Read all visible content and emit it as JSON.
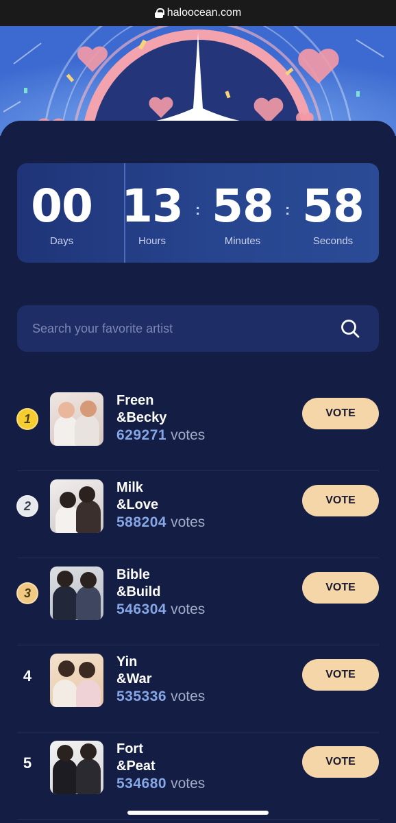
{
  "browser": {
    "url": "haloocean.com"
  },
  "countdown": {
    "days": "00",
    "days_label": "Days",
    "hours": "13",
    "hours_label": "Hours",
    "minutes": "58",
    "minutes_label": "Minutes",
    "seconds": "58",
    "seconds_label": "Seconds",
    "separator": ":"
  },
  "search": {
    "placeholder": "Search your favorite artist"
  },
  "ranking": [
    {
      "rank": "1",
      "line1": "Freen",
      "line2": "&Becky",
      "votes": "629271",
      "votes_label": "votes",
      "button": "VOTE",
      "medal_color": "#f5cd2f"
    },
    {
      "rank": "2",
      "line1": "Milk",
      "line2": "&Love",
      "votes": "588204",
      "votes_label": "votes",
      "button": "VOTE",
      "medal_color": "#e6e8ee"
    },
    {
      "rank": "3",
      "line1": "Bible",
      "line2": "&Build",
      "votes": "546304",
      "votes_label": "votes",
      "button": "VOTE",
      "medal_color": "#f1c983"
    },
    {
      "rank": "4",
      "line1": "Yin",
      "line2": "&War",
      "votes": "535336",
      "votes_label": "votes",
      "button": "VOTE"
    },
    {
      "rank": "5",
      "line1": "Fort",
      "line2": "&Peat",
      "votes": "534680",
      "votes_label": "votes",
      "button": "VOTE"
    }
  ],
  "colors": {
    "background": "#141d43",
    "accent_button": "#f5d6a8",
    "vote_count": "#86a6e6"
  }
}
